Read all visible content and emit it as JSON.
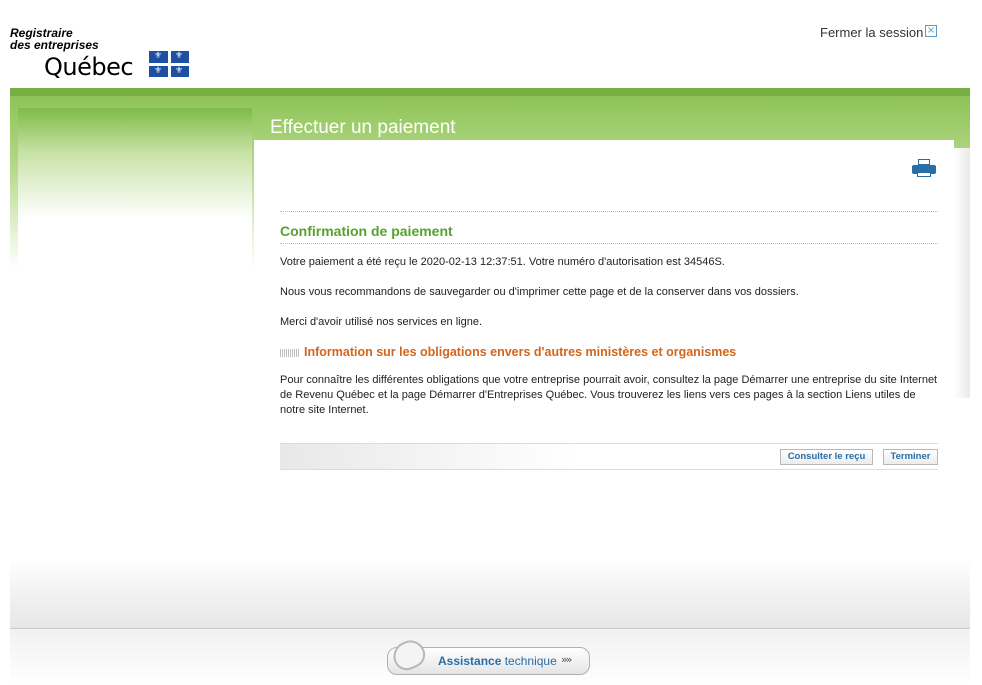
{
  "header": {
    "logo_line1": "Registraire",
    "logo_line2": "des entreprises",
    "logo_line3": "Québec",
    "logout_label": "Fermer la session",
    "logout_icon": "close-box-icon"
  },
  "page": {
    "title": "Effectuer un paiement",
    "print_icon": "printer-icon"
  },
  "confirmation": {
    "heading": "Confirmation de paiement",
    "paragraphs": [
      "Votre paiement a été reçu le 2020-02-13 12:37:51. Votre numéro d'autorisation est 34546S.",
      "Nous vous recommandons de sauvegarder ou d'imprimer cette page et de la conserver dans vos dossiers.",
      "Merci d'avoir utilisé nos services en ligne."
    ]
  },
  "obligations": {
    "heading": "Information sur les obligations envers d'autres ministères et organismes",
    "text": "Pour connaître les différentes obligations que votre entreprise pourrait avoir, consultez la page Démarrer une entreprise du site Internet de Revenu Québec et la page Démarrer d'Entreprises Québec. Vous trouverez les liens vers ces pages à la section Liens utiles de notre site Internet."
  },
  "buttons": {
    "receipt": "Consulter le reçu",
    "finish": "Terminer"
  },
  "footer": {
    "assist_bold": "Assistance",
    "assist_rest": " technique",
    "assist_arrows": "»»",
    "assist_icon": "mouse-icon"
  },
  "colors": {
    "brand_green": "#76b043",
    "heading_green": "#57a130",
    "heading_orange": "#d4651a",
    "link_blue": "#2a6ea6",
    "flag_blue": "#1f4fa3"
  }
}
